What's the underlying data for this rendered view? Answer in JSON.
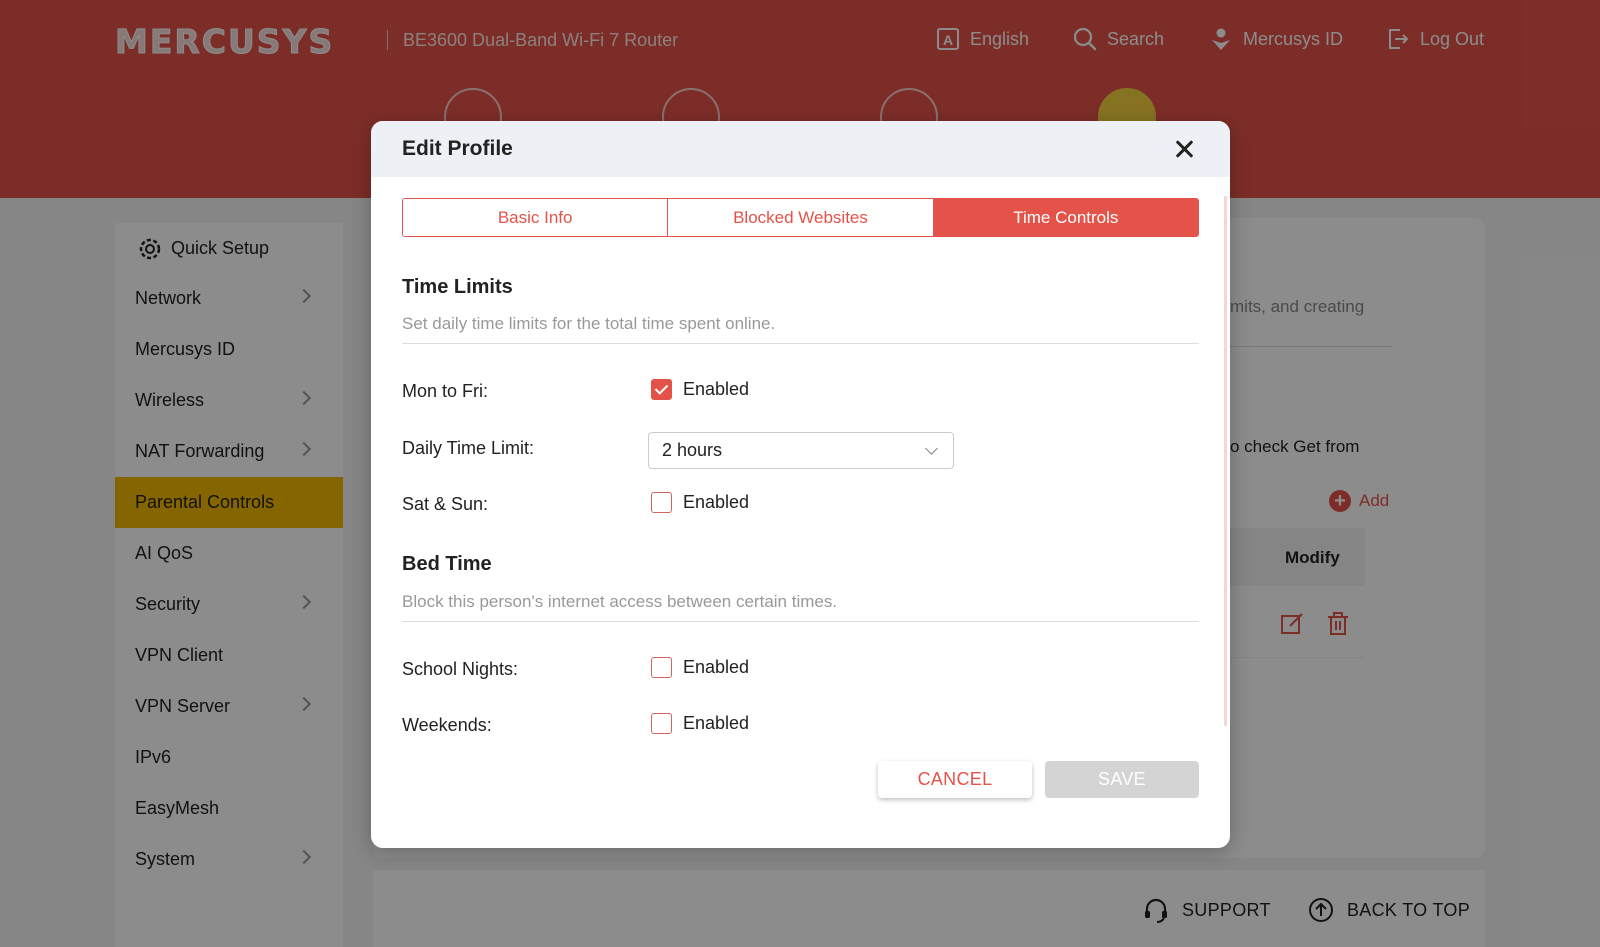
{
  "header": {
    "logo": "MERCUSYS",
    "model": "BE3600 Dual-Band Wi-Fi 7 Router",
    "nav": {
      "language": "English",
      "search": "Search",
      "mercusys_id": "Mercusys ID",
      "logout": "Log Out"
    },
    "colors": {
      "brand": "#e4534a",
      "active_tab": "#f4d23f"
    }
  },
  "sidebar": {
    "items": [
      {
        "label": "Quick Setup",
        "has_arrow": false
      },
      {
        "label": "Network",
        "has_arrow": true
      },
      {
        "label": "Mercusys ID",
        "has_arrow": false
      },
      {
        "label": "Wireless",
        "has_arrow": true
      },
      {
        "label": "NAT Forwarding",
        "has_arrow": true
      },
      {
        "label": "Parental Controls",
        "has_arrow": false,
        "active": true
      },
      {
        "label": "AI QoS",
        "has_arrow": false
      },
      {
        "label": "Security",
        "has_arrow": true
      },
      {
        "label": "VPN Client",
        "has_arrow": false
      },
      {
        "label": "VPN Server",
        "has_arrow": true
      },
      {
        "label": "IPv6",
        "has_arrow": false
      },
      {
        "label": "EasyMesh",
        "has_arrow": false
      },
      {
        "label": "System",
        "has_arrow": true
      }
    ],
    "active_color": "#f3b800"
  },
  "background": {
    "desc_fragment": "mits, and creating",
    "hint_fragment": "o check Get from",
    "add_label": "Add",
    "table_header_modify": "Modify"
  },
  "footer": {
    "support": "SUPPORT",
    "back_to_top": "BACK TO TOP"
  },
  "modal": {
    "title": "Edit Profile",
    "tabs": [
      {
        "label": "Basic Info",
        "active": false
      },
      {
        "label": "Blocked Websites",
        "active": false
      },
      {
        "label": "Time Controls",
        "active": true
      }
    ],
    "time_limits": {
      "title": "Time Limits",
      "description": "Set daily time limits for the total time spent online.",
      "mon_fri": {
        "label": "Mon to Fri:",
        "option": "Enabled",
        "checked": true
      },
      "daily_limit": {
        "label": "Daily Time Limit:",
        "value": "2 hours"
      },
      "sat_sun": {
        "label": "Sat & Sun:",
        "option": "Enabled",
        "checked": false
      }
    },
    "bed_time": {
      "title": "Bed Time",
      "description": "Block this person's internet access between certain times.",
      "school_nights": {
        "label": "School Nights:",
        "option": "Enabled",
        "checked": false
      },
      "weekends": {
        "label": "Weekends:",
        "option": "Enabled",
        "checked": false
      }
    },
    "buttons": {
      "cancel": "CANCEL",
      "save": "SAVE"
    }
  }
}
